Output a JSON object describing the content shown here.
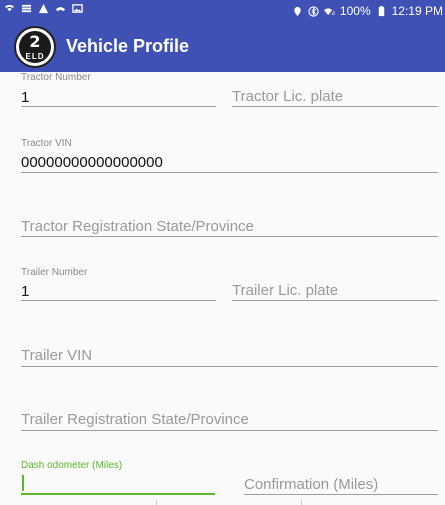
{
  "status_bar": {
    "battery": "100%",
    "time": "12:19 PM",
    "icons": [
      "wifi-icon",
      "notification-icon",
      "warning-icon",
      "cast-icon",
      "image-icon",
      "location-icon",
      "bluetooth-icon",
      "signal-icon",
      "battery-icon"
    ]
  },
  "app_bar": {
    "logo_number": "2",
    "logo_text": "ELD",
    "title": "Vehicle Profile"
  },
  "form": {
    "tractor_number": {
      "label": "Tractor Number",
      "value": "1"
    },
    "tractor_plate": {
      "placeholder": "Tractor Lic. plate"
    },
    "tractor_vin": {
      "label": "Tractor VIN",
      "value": "00000000000000000"
    },
    "tractor_registration": {
      "placeholder": "Tractor Registration State/Province"
    },
    "trailer_number": {
      "label": "Trailer Number",
      "value": "1"
    },
    "trailer_plate": {
      "placeholder": "Trailer Lic. plate"
    },
    "trailer_vin": {
      "placeholder": "Trailer VIN"
    },
    "trailer_registration": {
      "placeholder": "Trailer Registration State/Province"
    },
    "dash_odometer": {
      "label": "Dash odometer (Miles)",
      "value": ""
    },
    "confirmation": {
      "placeholder": "Confirmation (Miles)"
    }
  },
  "colors": {
    "primary": "#3f51b5",
    "focus_accent": "#5cb82e",
    "background": "#fafafa"
  }
}
